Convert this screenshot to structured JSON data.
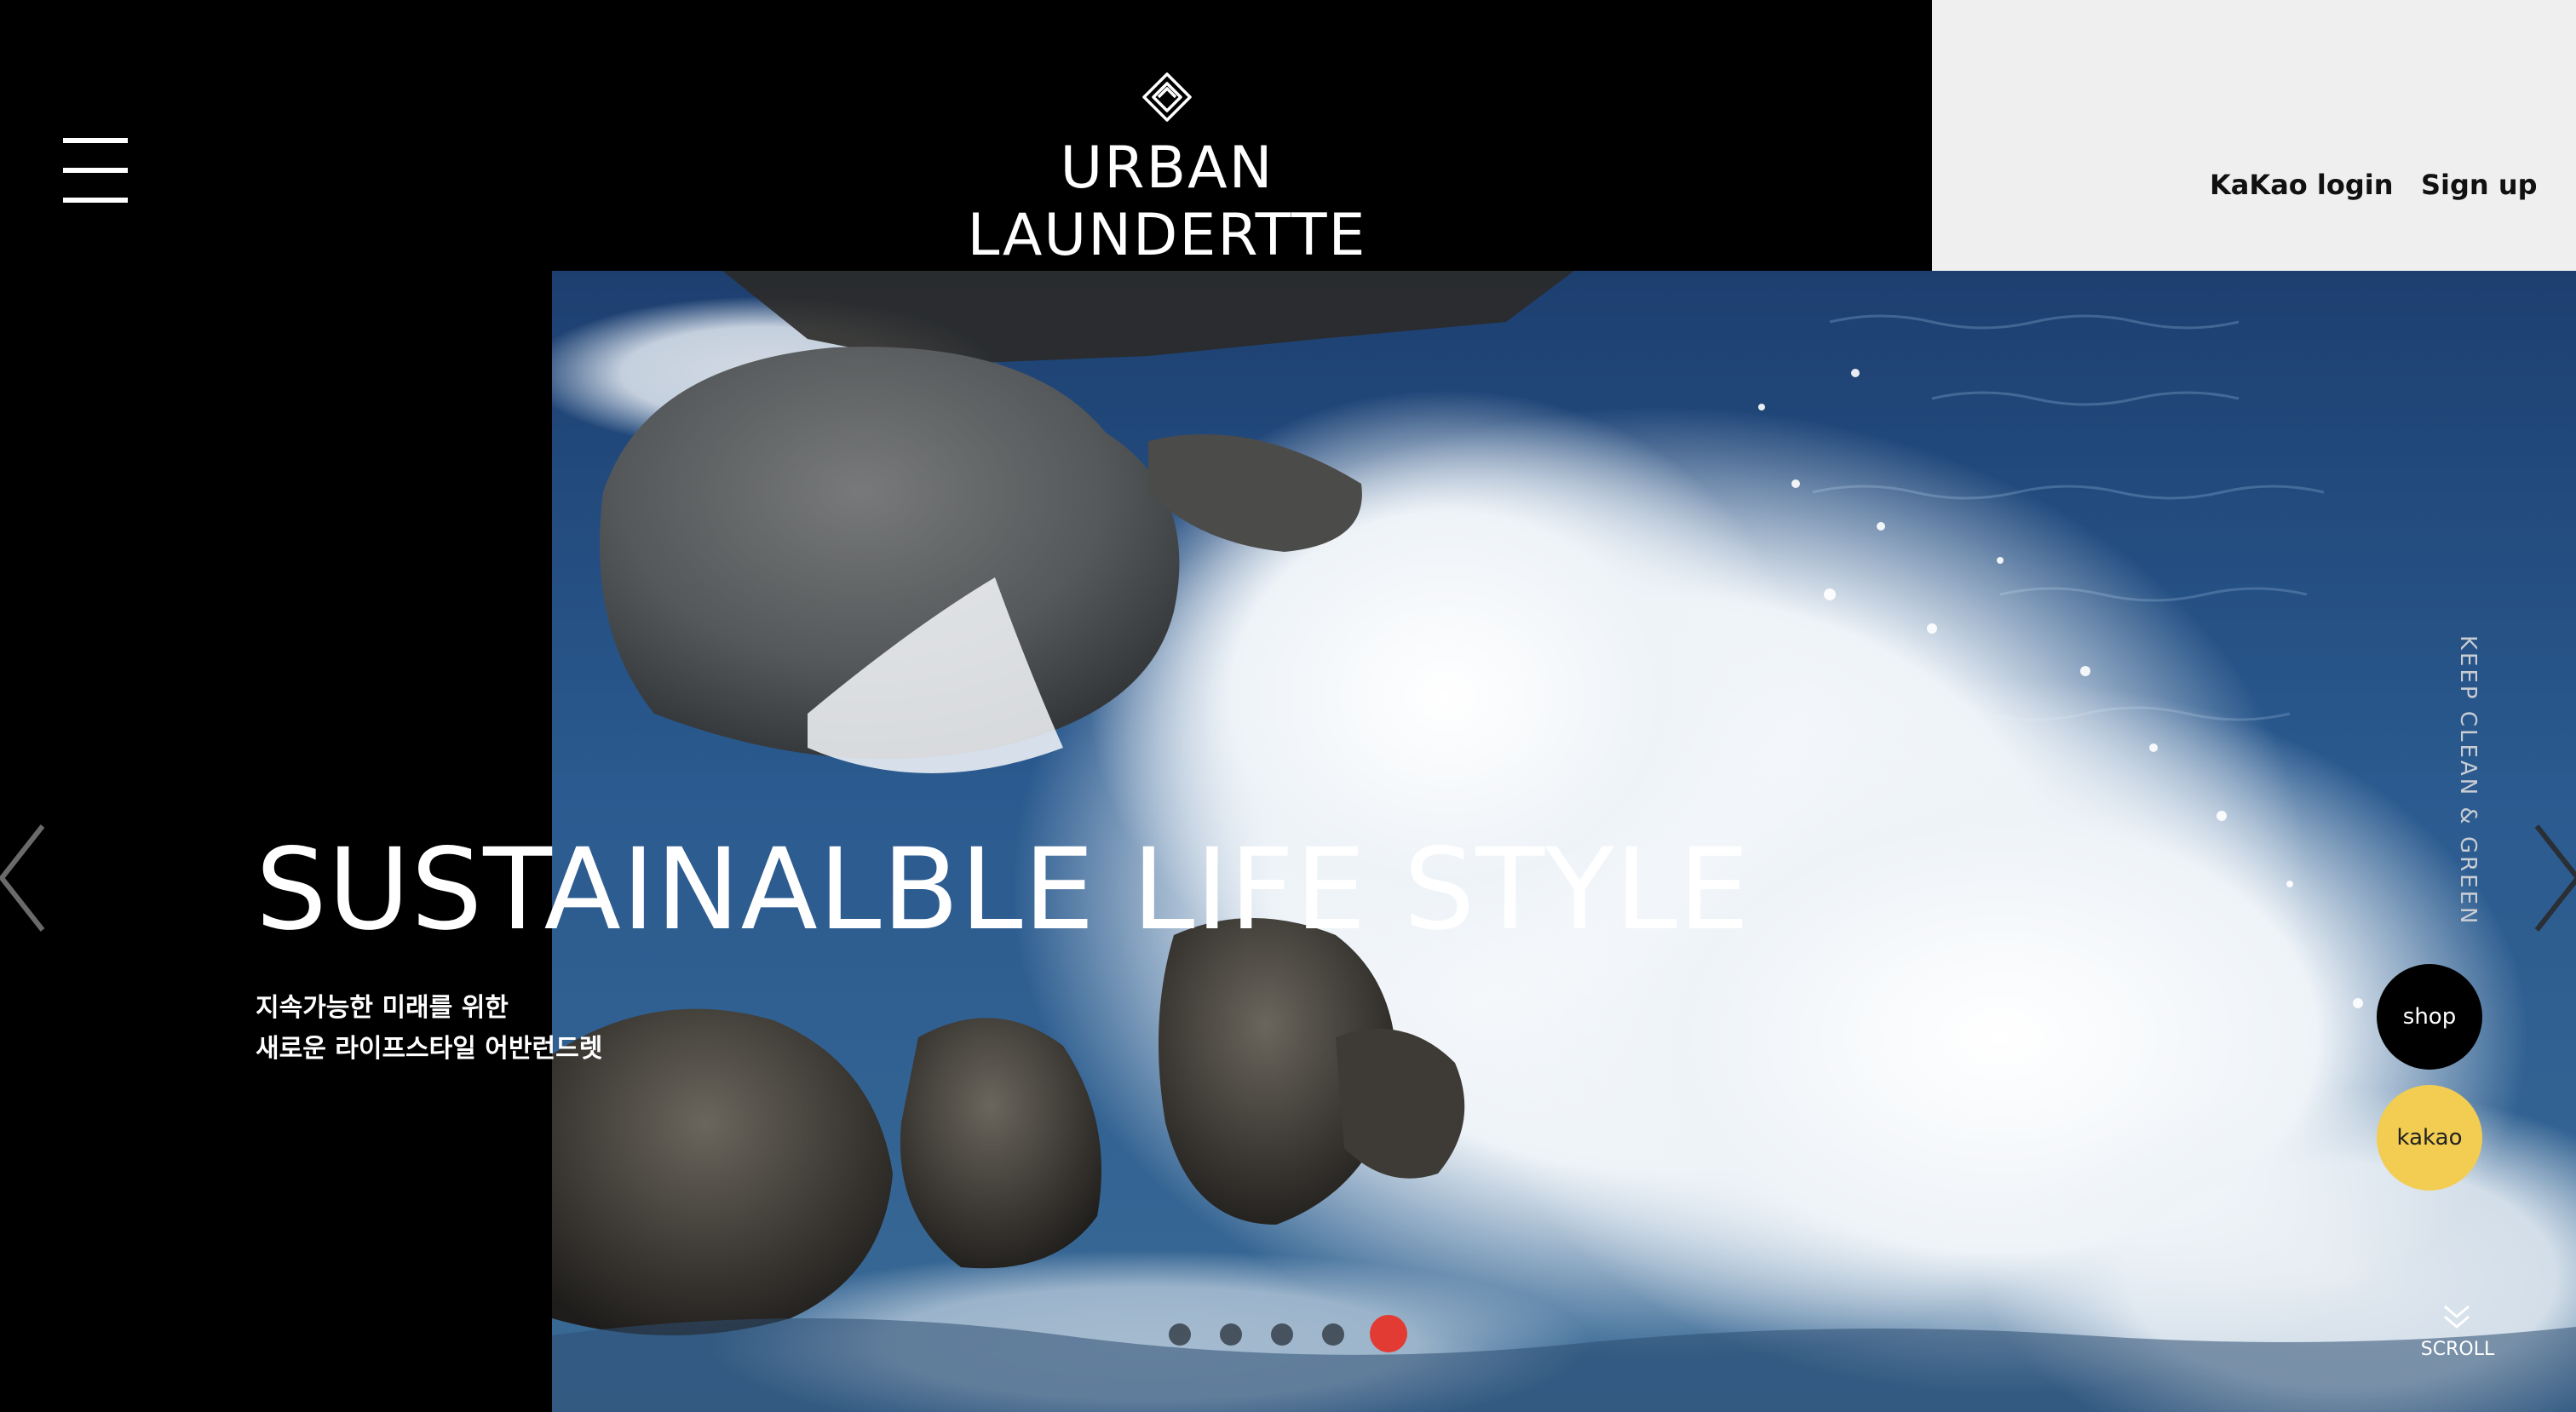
{
  "header": {
    "brand": "URBAN LAUNDERTTE",
    "nav": {
      "kakao_login": "KaKao login",
      "sign_up": "Sign up"
    },
    "icons": {
      "menu": "hamburger-menu-icon",
      "logo": "diamond-logo-icon"
    }
  },
  "hero": {
    "title": "SUSTAINALBLE LIFE STYLE",
    "subtitle_line1": "지속가능한 미래를 위한",
    "subtitle_line2": "새로운 라이프스타일 어반런드렛",
    "vertical_text": "KEEP CLEAN & GREEN",
    "image": "ocean-wave-on-rocks",
    "slides": {
      "count": 5,
      "active": 5
    }
  },
  "floating": {
    "shop": "shop",
    "kakao": "kakao",
    "scroll": "SCROLL"
  },
  "colors": {
    "header_dark": "#000000",
    "header_light": "#efefef",
    "kakao_yellow": "#f2cd52",
    "active_dot": "#e23b34"
  }
}
